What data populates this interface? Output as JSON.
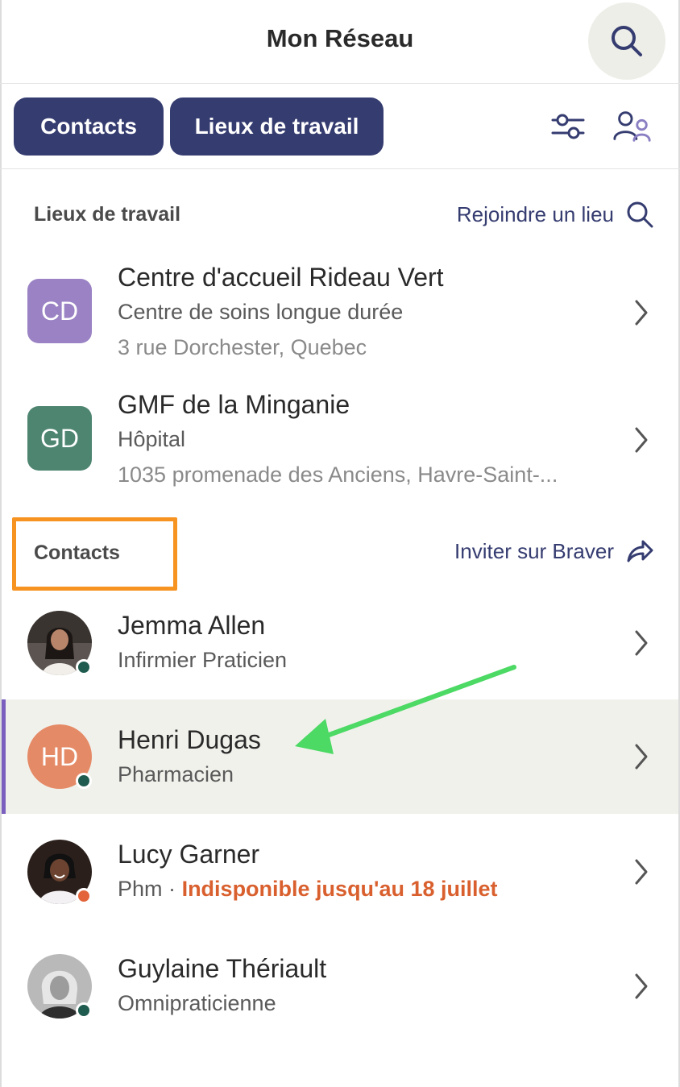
{
  "header": {
    "title": "Mon Réseau",
    "search_icon": "search-icon"
  },
  "tabs": [
    {
      "label": "Contacts"
    },
    {
      "label": "Lieux de travail"
    }
  ],
  "toolbar": {
    "filter_icon": "filter-sliders-icon",
    "people_icon": "people-icon"
  },
  "workplaces": {
    "title": "Lieux de travail",
    "action_label": "Rejoindre un lieu",
    "items": [
      {
        "initials": "CD",
        "color": "#9a82c4",
        "name": "Centre d'accueil Rideau Vert",
        "type": "Centre de soins longue durée",
        "address": "3 rue Dorchester, Quebec"
      },
      {
        "initials": "GD",
        "color": "#4e8571",
        "name": "GMF de la Minganie",
        "type": "Hôpital",
        "address": "1035 promenade des Anciens, Havre-Saint-..."
      }
    ]
  },
  "contacts": {
    "title": "Contacts",
    "action_label": "Inviter sur Braver",
    "items": [
      {
        "name": "Jemma Allen",
        "role": "Infirmier Praticien",
        "status": "online"
      },
      {
        "initials": "HD",
        "color": "#e58a66",
        "name": "Henri Dugas",
        "role": "Pharmacien",
        "status": "online"
      },
      {
        "name": "Lucy Garner",
        "role": "Phm",
        "separator": "·",
        "availability": "Indisponible jusqu'au 18 juillet",
        "status": "away"
      },
      {
        "name": "Guylaine Thériault",
        "role": "Omnipraticienne",
        "status": "online"
      }
    ]
  },
  "colors": {
    "accent": "#353c70",
    "highlight_box": "#f79321",
    "annotation_arrow": "#4cd964",
    "unavailable": "#d9602e"
  }
}
